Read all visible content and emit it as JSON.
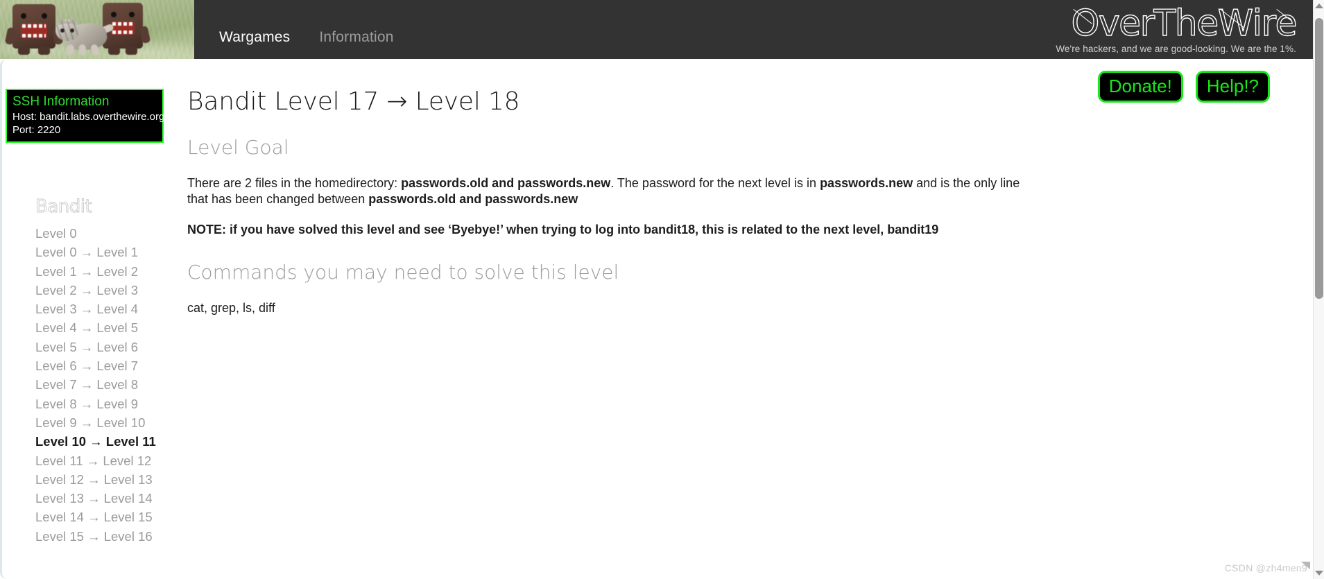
{
  "header": {
    "nav": [
      {
        "label": "Wargames",
        "active": true
      },
      {
        "label": "Information",
        "active": false
      }
    ],
    "brand_name": "OverTheWire",
    "brand_tagline": "We're hackers, and we are good-looking. We are the 1%.",
    "photo_alt": "domo-plush-and-kitten-photo"
  },
  "sidebar": {
    "ssh": {
      "title": "SSH Information",
      "host_line": "Host: bandit.labs.overthewire.org",
      "port_line": "Port: 2220"
    },
    "game_title": "Bandit",
    "levels": [
      {
        "label": "Level 0",
        "current": false
      },
      {
        "label": "Level 0 → Level 1",
        "current": false
      },
      {
        "label": "Level 1 → Level 2",
        "current": false
      },
      {
        "label": "Level 2 → Level 3",
        "current": false
      },
      {
        "label": "Level 3 → Level 4",
        "current": false
      },
      {
        "label": "Level 4 → Level 5",
        "current": false
      },
      {
        "label": "Level 5 → Level 6",
        "current": false
      },
      {
        "label": "Level 6 → Level 7",
        "current": false
      },
      {
        "label": "Level 7 → Level 8",
        "current": false
      },
      {
        "label": "Level 8 → Level 9",
        "current": false
      },
      {
        "label": "Level 9 → Level 10",
        "current": false
      },
      {
        "label": "Level 10 → Level 11",
        "current": true
      },
      {
        "label": "Level 11 → Level 12",
        "current": false
      },
      {
        "label": "Level 12 → Level 13",
        "current": false
      },
      {
        "label": "Level 13 → Level 14",
        "current": false
      },
      {
        "label": "Level 14 → Level 15",
        "current": false
      },
      {
        "label": "Level 15 → Level 16",
        "current": false
      }
    ]
  },
  "main": {
    "donate_label": "Donate!",
    "help_label": "Help!?",
    "page_title": "Bandit Level 17 → Level 18",
    "goal_heading": "Level Goal",
    "goal_text": {
      "part1": "There are 2 files in the homedirectory: ",
      "bold1": "passwords.old and passwords.new",
      "part2": ". The password for the next level is in ",
      "bold2": "passwords.new",
      "part3": " and is the only line that has been changed between ",
      "bold3": "passwords.old and passwords.new"
    },
    "note_text": "NOTE: if you have solved this level and see ‘Byebye!’ when trying to log into bandit18, this is related to the next level, bandit19",
    "commands_heading": "Commands you may need to solve this level",
    "commands_text": "cat, grep, ls, diff"
  },
  "watermark": "CSDN @zh4men9",
  "colors": {
    "header_bg": "#333333",
    "terminal_green": "#25ff25",
    "pill_green": "#17e817",
    "sidebar_border": "#dce8ea",
    "muted_text": "#9a9a9a"
  }
}
